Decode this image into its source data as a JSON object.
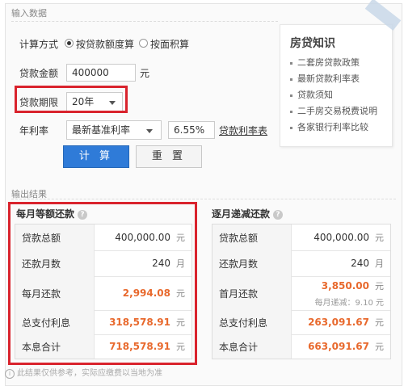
{
  "input_section": {
    "title": "输入数据",
    "calc_method": {
      "label": "计算方式",
      "options": [
        "按贷款额度算",
        "按面积算"
      ],
      "selected": "按贷款额度算"
    },
    "loan_amount": {
      "label": "贷款金额",
      "value": "400000",
      "unit": "元"
    },
    "loan_term": {
      "label": "贷款期限",
      "selected": "20年"
    },
    "annual_rate": {
      "label": "年利率",
      "selected": "最新基准利率",
      "value": "6.55%",
      "link": "贷款利率表"
    },
    "buttons": {
      "calculate": "计 算",
      "reset": "重 置"
    }
  },
  "knowledge_card": {
    "title": "房贷知识",
    "items": [
      "二套房贷款政策",
      "最新贷款利率表",
      "贷款须知",
      "二手房交易税费说明",
      "各家银行利率比较"
    ]
  },
  "output_section": {
    "title": "输出结果",
    "equal_installment": {
      "title": "每月等额还款",
      "rows": [
        {
          "label": "贷款总额",
          "value": "400,000.00",
          "unit": "元"
        },
        {
          "label": "还款月数",
          "value": "240",
          "unit": "月"
        },
        {
          "label": "每月还款",
          "value": "2,994.08",
          "unit": "元"
        },
        {
          "label": "总支付利息",
          "value": "318,578.91",
          "unit": "元"
        },
        {
          "label": "本息合计",
          "value": "718,578.91",
          "unit": "元"
        }
      ]
    },
    "decreasing": {
      "title": "逐月递减还款",
      "rows": [
        {
          "label": "贷款总额",
          "value": "400,000.00",
          "unit": "元"
        },
        {
          "label": "还款月数",
          "value": "240",
          "unit": "月"
        },
        {
          "label": "首月还款",
          "value": "3,850.00",
          "unit": "元",
          "sub": "每月递减：9.10 元"
        },
        {
          "label": "总支付利息",
          "value": "263,091.67",
          "unit": "元"
        },
        {
          "label": "本息合计",
          "value": "663,091.67",
          "unit": "元"
        }
      ]
    }
  },
  "footer_note": "此结果仅供参考，实际应缴费以当地为准",
  "colors": {
    "highlight": "#d9232d",
    "accent": "#e8692d",
    "primary_button": "#2f7bd8"
  }
}
